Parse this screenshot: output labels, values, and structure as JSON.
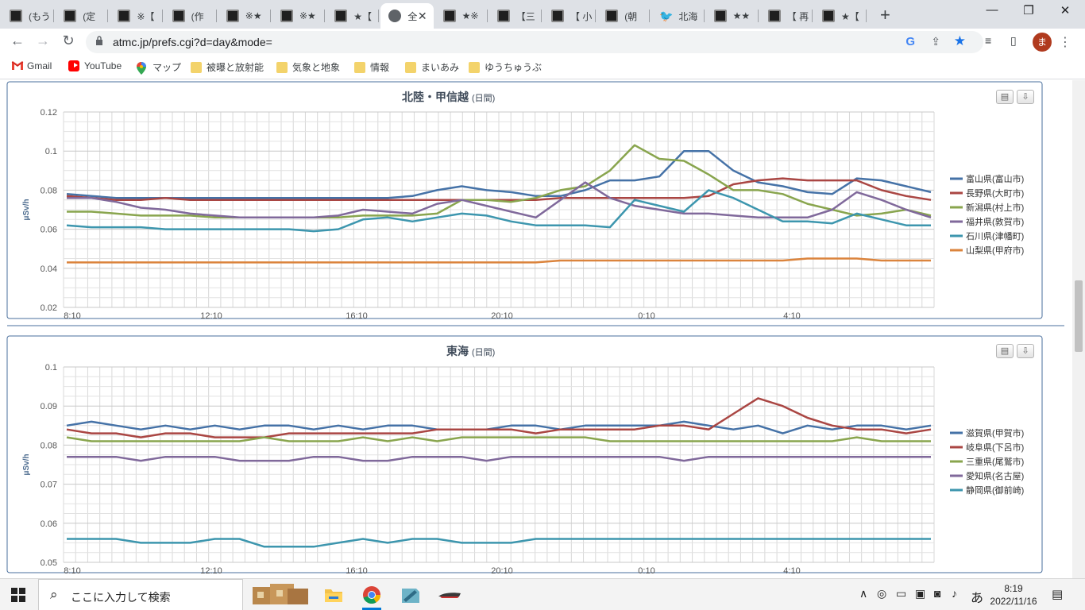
{
  "tabs": [
    {
      "title": "(もう",
      "icon": "site-icon"
    },
    {
      "title": "(定",
      "icon": "site-icon"
    },
    {
      "title": "※【",
      "icon": "site-icon"
    },
    {
      "title": "(作",
      "icon": "site-icon"
    },
    {
      "title": "※★",
      "icon": "site-icon"
    },
    {
      "title": "※★",
      "icon": "site-icon"
    },
    {
      "title": "★【",
      "icon": "site-icon"
    },
    {
      "title": "全",
      "icon": "globe-icon",
      "active": true
    },
    {
      "title": "★※",
      "icon": "site-icon"
    },
    {
      "title": "【三",
      "icon": "site-icon"
    },
    {
      "title": "【 小",
      "icon": "site-icon"
    },
    {
      "title": "(朝",
      "icon": "site-icon"
    },
    {
      "title": "北海",
      "icon": "twitter-icon"
    },
    {
      "title": "★★",
      "icon": "site-icon"
    },
    {
      "title": "【 再",
      "icon": "site-icon"
    },
    {
      "title": "★【",
      "icon": "site-icon"
    }
  ],
  "newtab_label": "+",
  "window_controls": {
    "minimize": "—",
    "restore": "❐",
    "close": "✕"
  },
  "toolbar": {
    "url": "atmc.jp/prefs.cgi?d=day&mode=",
    "google_label": "G",
    "avatar_letter": "ま"
  },
  "bookmarks": [
    {
      "label": "Gmail",
      "icon": "gmail-icon"
    },
    {
      "label": "YouTube",
      "icon": "youtube-icon"
    },
    {
      "label": "マップ",
      "icon": "maps-icon"
    },
    {
      "label": "被曝と放射能",
      "icon": "folder-icon"
    },
    {
      "label": "気象と地象",
      "icon": "folder-icon"
    },
    {
      "label": "情報",
      "icon": "folder-icon"
    },
    {
      "label": "まいあみ",
      "icon": "folder-icon"
    },
    {
      "label": "ゆうちゅうぶ",
      "icon": "folder-icon"
    }
  ],
  "chart_data": [
    {
      "type": "line",
      "title": "北陸・甲信越",
      "subtitle": "(日間)",
      "ylabel": "μSv/h",
      "ylim": [
        0.02,
        0.12
      ],
      "yticks": [
        "0.12",
        "0.1",
        "0.08",
        "0.06",
        "0.04",
        "0.02"
      ],
      "xticks": [
        "8:10",
        "12:10",
        "16:10",
        "20:10",
        "0:10",
        "4:10"
      ],
      "series": [
        {
          "name": "富山県(富山市)",
          "color": "#4572a7",
          "values": [
            0.078,
            0.077,
            0.076,
            0.076,
            0.076,
            0.076,
            0.076,
            0.076,
            0.076,
            0.076,
            0.076,
            0.076,
            0.076,
            0.076,
            0.077,
            0.08,
            0.082,
            0.08,
            0.079,
            0.077,
            0.077,
            0.08,
            0.085,
            0.085,
            0.087,
            0.1,
            0.1,
            0.09,
            0.084,
            0.082,
            0.079,
            0.078,
            0.086,
            0.085,
            0.082,
            0.079
          ]
        },
        {
          "name": "長野県(大町市)",
          "color": "#aa4643",
          "values": [
            0.077,
            0.076,
            0.075,
            0.075,
            0.076,
            0.075,
            0.075,
            0.075,
            0.075,
            0.075,
            0.075,
            0.075,
            0.075,
            0.075,
            0.075,
            0.075,
            0.075,
            0.075,
            0.075,
            0.075,
            0.076,
            0.076,
            0.076,
            0.076,
            0.076,
            0.076,
            0.077,
            0.083,
            0.085,
            0.086,
            0.085,
            0.085,
            0.085,
            0.08,
            0.077,
            0.075
          ]
        },
        {
          "name": "新潟県(村上市)",
          "color": "#89a54e",
          "values": [
            0.069,
            0.069,
            0.068,
            0.067,
            0.067,
            0.067,
            0.066,
            0.066,
            0.066,
            0.066,
            0.066,
            0.066,
            0.067,
            0.067,
            0.067,
            0.068,
            0.075,
            0.075,
            0.074,
            0.076,
            0.08,
            0.082,
            0.09,
            0.103,
            0.096,
            0.095,
            0.088,
            0.08,
            0.08,
            0.078,
            0.073,
            0.07,
            0.067,
            0.068,
            0.07,
            0.067
          ]
        },
        {
          "name": "福井県(敦賀市)",
          "color": "#80699b",
          "values": [
            0.076,
            0.076,
            0.074,
            0.071,
            0.07,
            0.068,
            0.067,
            0.066,
            0.066,
            0.066,
            0.066,
            0.067,
            0.07,
            0.069,
            0.068,
            0.073,
            0.075,
            0.072,
            0.069,
            0.066,
            0.075,
            0.084,
            0.076,
            0.072,
            0.07,
            0.068,
            0.068,
            0.067,
            0.066,
            0.066,
            0.066,
            0.07,
            0.079,
            0.075,
            0.07,
            0.066
          ]
        },
        {
          "name": "石川県(津幡町)",
          "color": "#3d96ae",
          "values": [
            0.062,
            0.061,
            0.061,
            0.061,
            0.06,
            0.06,
            0.06,
            0.06,
            0.06,
            0.06,
            0.059,
            0.06,
            0.065,
            0.066,
            0.064,
            0.066,
            0.068,
            0.067,
            0.064,
            0.062,
            0.062,
            0.062,
            0.061,
            0.075,
            0.072,
            0.069,
            0.08,
            0.076,
            0.07,
            0.064,
            0.064,
            0.063,
            0.068,
            0.065,
            0.062,
            0.062
          ]
        },
        {
          "name": "山梨県(甲府市)",
          "color": "#db843d",
          "values": [
            0.043,
            0.043,
            0.043,
            0.043,
            0.043,
            0.043,
            0.043,
            0.043,
            0.043,
            0.043,
            0.043,
            0.043,
            0.043,
            0.043,
            0.043,
            0.043,
            0.043,
            0.043,
            0.043,
            0.043,
            0.044,
            0.044,
            0.044,
            0.044,
            0.044,
            0.044,
            0.044,
            0.044,
            0.044,
            0.044,
            0.045,
            0.045,
            0.045,
            0.044,
            0.044,
            0.044
          ]
        }
      ]
    },
    {
      "type": "line",
      "title": "東海",
      "subtitle": "(日間)",
      "ylabel": "μSv/h",
      "ylim": [
        0.05,
        0.1
      ],
      "yticks": [
        "0.1",
        "0.09",
        "0.08",
        "0.07",
        "0.06",
        "0.05"
      ],
      "xticks": [
        "8:10",
        "12:10",
        "16:10",
        "20:10",
        "0:10",
        "4:10"
      ],
      "series": [
        {
          "name": "滋賀県(甲賀市)",
          "color": "#4572a7",
          "values": [
            0.085,
            0.086,
            0.085,
            0.084,
            0.085,
            0.084,
            0.085,
            0.084,
            0.085,
            0.085,
            0.084,
            0.085,
            0.084,
            0.085,
            0.085,
            0.084,
            0.084,
            0.084,
            0.085,
            0.085,
            0.084,
            0.085,
            0.085,
            0.085,
            0.085,
            0.086,
            0.085,
            0.084,
            0.085,
            0.083,
            0.085,
            0.084,
            0.085,
            0.085,
            0.084,
            0.085
          ]
        },
        {
          "name": "岐阜県(下呂市)",
          "color": "#aa4643",
          "values": [
            0.084,
            0.083,
            0.083,
            0.082,
            0.083,
            0.083,
            0.082,
            0.082,
            0.082,
            0.083,
            0.083,
            0.083,
            0.083,
            0.083,
            0.083,
            0.084,
            0.084,
            0.084,
            0.084,
            0.083,
            0.084,
            0.084,
            0.084,
            0.084,
            0.085,
            0.085,
            0.084,
            0.088,
            0.092,
            0.09,
            0.087,
            0.085,
            0.084,
            0.084,
            0.083,
            0.084
          ]
        },
        {
          "name": "三重県(尾鷲市)",
          "color": "#89a54e",
          "values": [
            0.082,
            0.081,
            0.081,
            0.081,
            0.081,
            0.081,
            0.081,
            0.081,
            0.082,
            0.081,
            0.081,
            0.081,
            0.082,
            0.081,
            0.082,
            0.081,
            0.082,
            0.082,
            0.082,
            0.082,
            0.082,
            0.082,
            0.081,
            0.081,
            0.081,
            0.081,
            0.081,
            0.081,
            0.081,
            0.081,
            0.081,
            0.081,
            0.082,
            0.081,
            0.081,
            0.081
          ]
        },
        {
          "name": "愛知県(名古屋)",
          "color": "#80699b",
          "values": [
            0.077,
            0.077,
            0.077,
            0.076,
            0.077,
            0.077,
            0.077,
            0.076,
            0.076,
            0.076,
            0.077,
            0.077,
            0.076,
            0.076,
            0.077,
            0.077,
            0.077,
            0.076,
            0.077,
            0.077,
            0.077,
            0.077,
            0.077,
            0.077,
            0.077,
            0.076,
            0.077,
            0.077,
            0.077,
            0.077,
            0.077,
            0.077,
            0.077,
            0.077,
            0.077,
            0.077
          ]
        },
        {
          "name": "静岡県(御前崎)",
          "color": "#3d96ae",
          "values": [
            0.056,
            0.056,
            0.056,
            0.055,
            0.055,
            0.055,
            0.056,
            0.056,
            0.054,
            0.054,
            0.054,
            0.055,
            0.056,
            0.055,
            0.056,
            0.056,
            0.055,
            0.055,
            0.055,
            0.056,
            0.056,
            0.056,
            0.056,
            0.056,
            0.056,
            0.056,
            0.056,
            0.056,
            0.056,
            0.056,
            0.056,
            0.056,
            0.056,
            0.056,
            0.056,
            0.056
          ]
        }
      ]
    }
  ],
  "taskbar": {
    "search_placeholder": "ここに入力して検索",
    "ime_label": "あ",
    "time": "8:19",
    "date": "2022/11/16"
  }
}
